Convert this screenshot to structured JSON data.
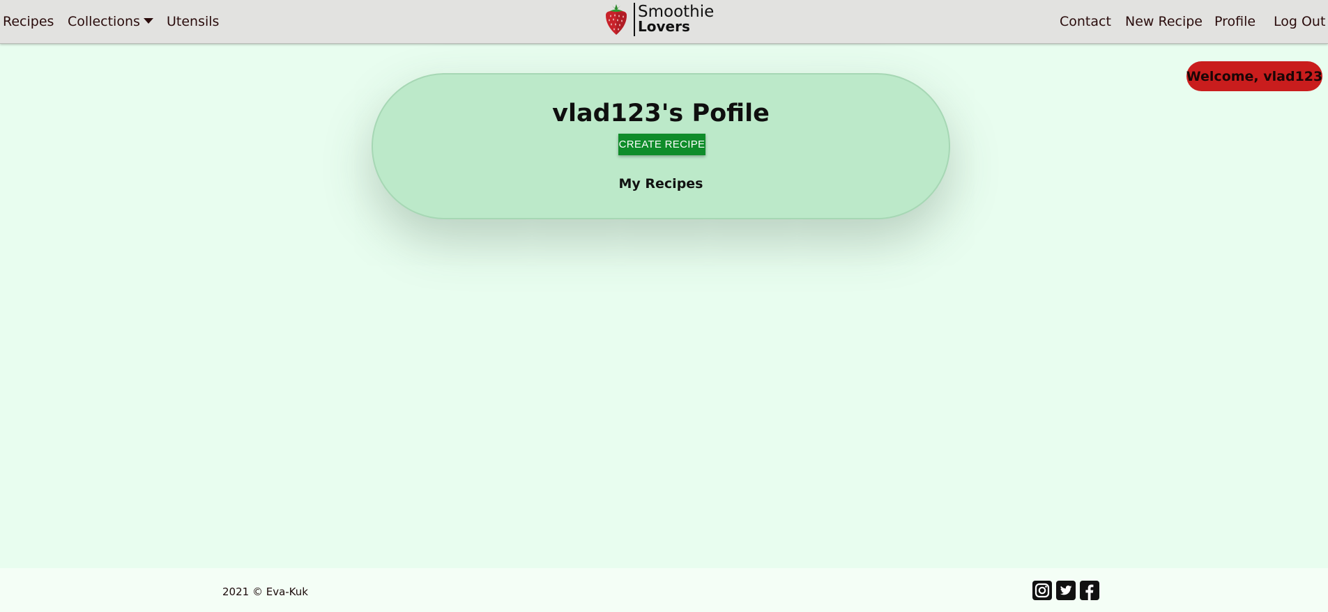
{
  "nav": {
    "left_links": [
      "Recipes",
      "Collections",
      "Utensils"
    ],
    "right_links": [
      "Contact",
      "New Recipe",
      "Profile",
      "Log Out"
    ],
    "brand_line1": "Smoothie",
    "brand_line2": "Lovers",
    "logo_icon": "strawberry-icon",
    "collections_icon": "caret-down-icon"
  },
  "welcome": {
    "text": "Welcome, vlad123",
    "color": "#c91d1d"
  },
  "profile": {
    "title": "vlad123's Pofile",
    "create_button_label": "CREATE RECIPE",
    "my_recipes_label": "My Recipes",
    "card_color": "#bce9c9",
    "button_color": "#0f8c2a"
  },
  "footer": {
    "copyright": "2021 © Eva-Kuk",
    "social_icons": [
      "instagram-icon",
      "twitter-icon",
      "facebook-icon"
    ]
  },
  "colors": {
    "background": "#e8fdef",
    "navbar": "#e2e2e0",
    "footer": "#f4fef6"
  }
}
